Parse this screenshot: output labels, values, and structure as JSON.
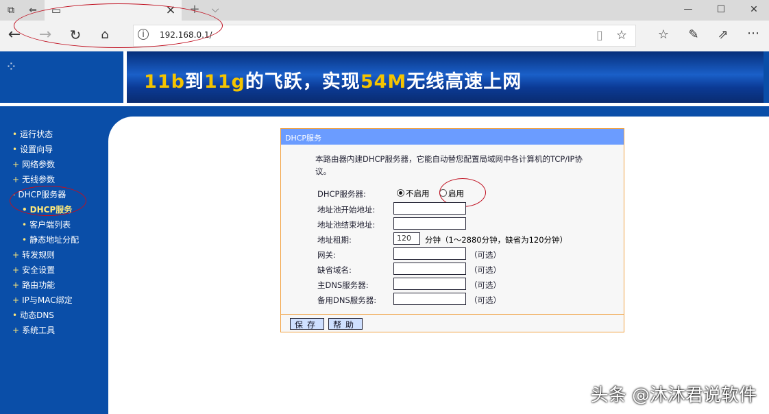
{
  "browser": {
    "url": "192.168.0.1/",
    "tab_close": "×",
    "new_tab": "+",
    "tab_menu": "⌵",
    "min": "—",
    "max": "☐",
    "close": "✕"
  },
  "banner": {
    "p1": "11b",
    "p2": "到",
    "p3": "11g",
    "p4": "的飞跃，实现",
    "p5": "54M",
    "p6": "无线高速上网"
  },
  "sidebar": {
    "items": [
      {
        "label": "运行状态",
        "bullet": "•"
      },
      {
        "label": "设置向导",
        "bullet": "•"
      },
      {
        "label": "网络参数",
        "bullet": "+"
      },
      {
        "label": "无线参数",
        "bullet": "+"
      },
      {
        "label": "DHCP服务器",
        "bullet": "-"
      },
      {
        "label": "DHCP服务",
        "bullet": "•"
      },
      {
        "label": "客户端列表",
        "bullet": "•"
      },
      {
        "label": "静态地址分配",
        "bullet": "•"
      },
      {
        "label": "转发规则",
        "bullet": "+"
      },
      {
        "label": "安全设置",
        "bullet": "+"
      },
      {
        "label": "路由功能",
        "bullet": "+"
      },
      {
        "label": "IP与MAC绑定",
        "bullet": "+"
      },
      {
        "label": "动态DNS",
        "bullet": "•"
      },
      {
        "label": "系统工具",
        "bullet": "+"
      }
    ]
  },
  "panel": {
    "title": "DHCP服务",
    "description": "本路由器内建DHCP服务器，它能自动替您配置局域网中各计算机的TCP/IP协议。",
    "dhcp_label": "DHCP服务器:",
    "opt_off": "不启用",
    "opt_on": "启用",
    "selected": "不启用",
    "start_label": "地址池开始地址:",
    "end_label": "地址池结束地址:",
    "lease_label": "地址租期:",
    "lease_value": "120",
    "lease_hint": "分钟（1～2880分钟，缺省为120分钟）",
    "gateway_label": "网关:",
    "domain_label": "缺省域名:",
    "dns1_label": "主DNS服务器:",
    "dns2_label": "备用DNS服务器:",
    "optional": "（可选）",
    "save": "保存",
    "help": "帮助"
  },
  "watermark": "头条 @沐沐君说软件"
}
